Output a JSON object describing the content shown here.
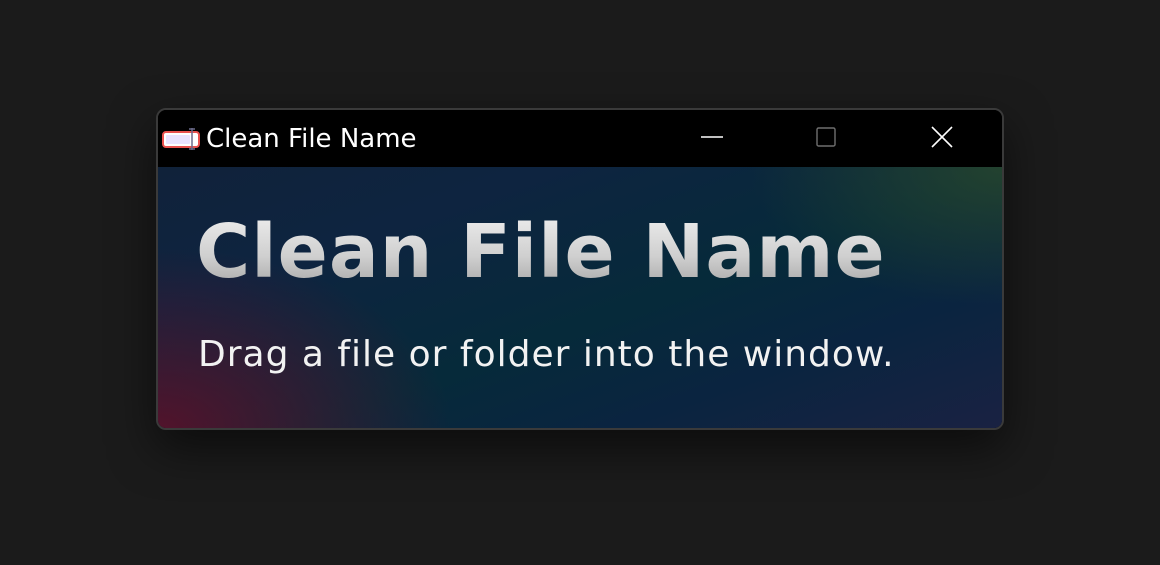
{
  "window": {
    "title": "Clean File Name",
    "icon": "app-file-icon",
    "buttons": {
      "minimize_icon": "minimize-icon",
      "maximize_icon": "maximize-icon",
      "close_icon": "close-icon"
    }
  },
  "main": {
    "heading": "Clean File Name",
    "instruction": "Drag a file or folder into the window."
  },
  "colors": {
    "background": "#1b1b1b",
    "titlebar": "#000000",
    "text": "#f2f2f2",
    "icon_accent": "#e8524f"
  }
}
